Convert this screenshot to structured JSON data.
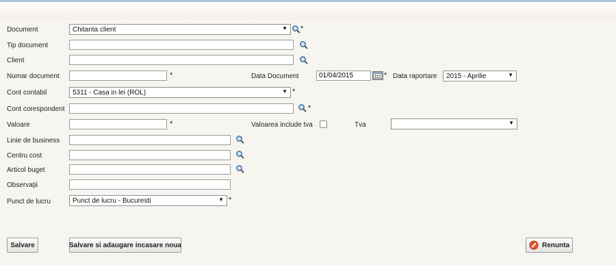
{
  "form": {
    "document": {
      "label": "Document",
      "value": "Chitanta client"
    },
    "tip_document": {
      "label": "Tip document",
      "value": ""
    },
    "client": {
      "label": "Client",
      "value": ""
    },
    "numar_document": {
      "label": "Numar document",
      "value": ""
    },
    "data_document": {
      "label": "Data Document",
      "value": "01/04/2015"
    },
    "data_raportare": {
      "label": "Data raportare",
      "value": "2015 - Aprilie"
    },
    "cont_contabil": {
      "label": "Cont contabil",
      "value": "5311 - Casa in lei (ROL)"
    },
    "cont_corespondent": {
      "label": "Cont corespondent",
      "value": ""
    },
    "valoare": {
      "label": "Valoare",
      "value": ""
    },
    "valoarea_include_tva": {
      "label": "Valoarea include tva",
      "checked": false
    },
    "tva": {
      "label": "Tva",
      "value": ""
    },
    "linie_de_business": {
      "label": "Linie de business",
      "value": ""
    },
    "centru_cost": {
      "label": "Centru cost",
      "value": ""
    },
    "articol_buget": {
      "label": "Articol buget",
      "value": ""
    },
    "observatii": {
      "label": "Observaţii",
      "value": ""
    },
    "punct_de_lucru": {
      "label": "Punct de lucru",
      "value": "Punct de lucru - Bucuresti"
    },
    "required_mark": "*"
  },
  "buttons": {
    "save": "Salvare",
    "save_and_add": "Salvare si adaugare incasare noua",
    "cancel": "Renunta"
  },
  "icons": {
    "search": "magnifier-icon",
    "calendar": "calendar-icon",
    "cancel": "cancel-icon"
  },
  "colors": {
    "background": "#f7f5ef",
    "topbar": "#a9c6e2",
    "cancel_icon": "#e2532a"
  }
}
